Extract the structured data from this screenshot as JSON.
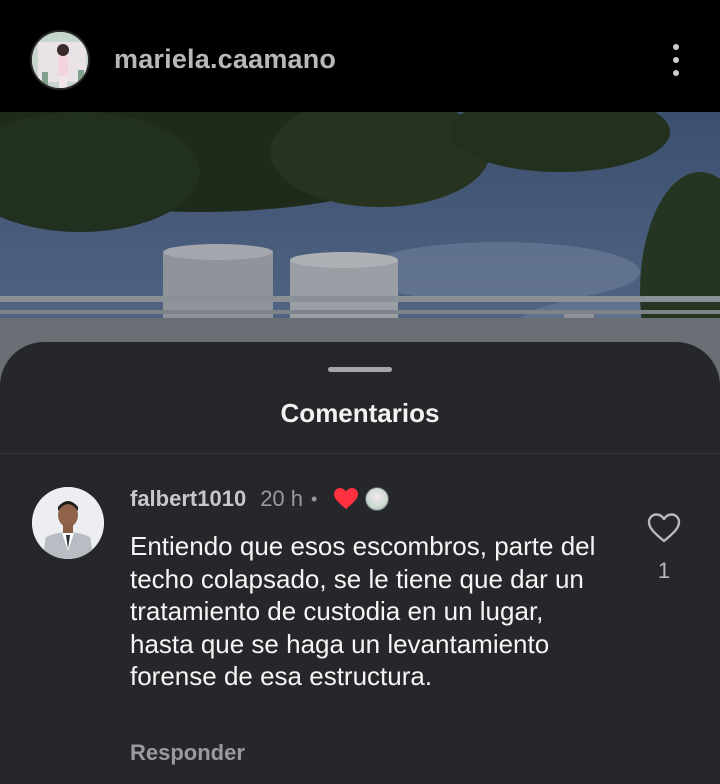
{
  "header": {
    "username": "mariela.caamano",
    "avatar_icon": "profile-photo",
    "menu_icon": "more-vertical-icon"
  },
  "sheet": {
    "title": "Comentarios"
  },
  "comments": [
    {
      "username": "falbert1010",
      "time": "20 h",
      "separator": "•",
      "author_liked": true,
      "text": "Entiendo que esos escombros, parte del techo colapsado, se le tiene que dar un tratamiento de custodia en un lugar, hasta que se haga un levantamiento forense de esa estructura.",
      "reply_label": "Responder",
      "like_count": "1"
    }
  ],
  "colors": {
    "sheet_bg": "#25272a",
    "heart_red": "#ff3040",
    "text_primary": "#f5f5f5",
    "text_secondary": "#9a9b9e"
  }
}
